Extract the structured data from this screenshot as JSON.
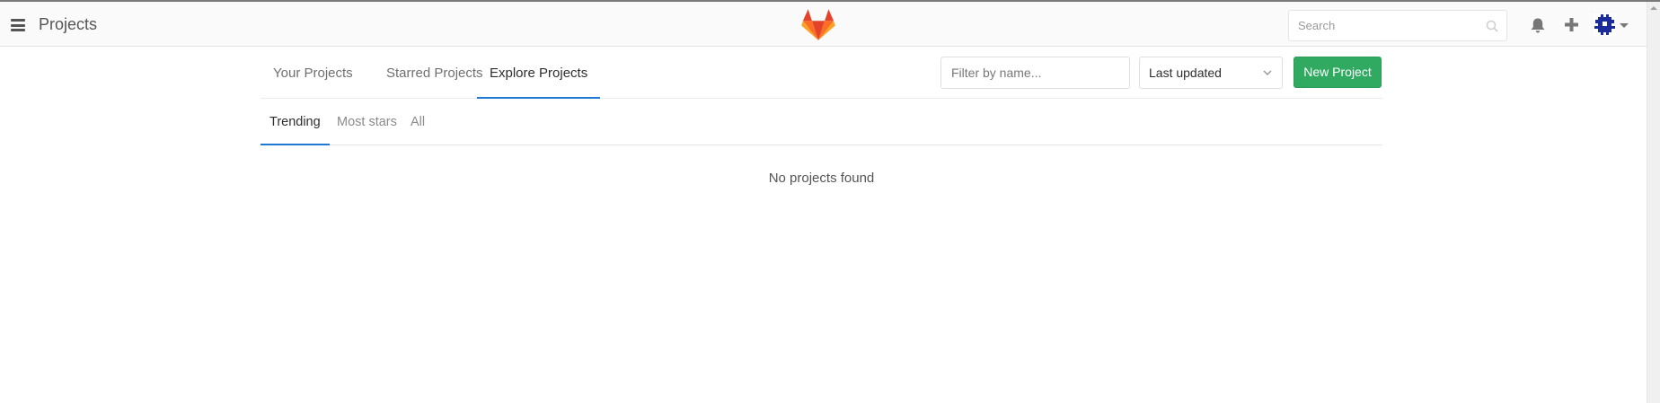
{
  "header": {
    "title": "Projects",
    "menu_icon": "hamburger-menu-icon",
    "logo": "gitlab-tanuki-logo",
    "search": {
      "placeholder": "Search",
      "value": ""
    },
    "icons": [
      "bell-icon",
      "plus-icon",
      "avatar",
      "caret-down-icon"
    ]
  },
  "tabs": [
    {
      "label": "Your Projects",
      "active": false
    },
    {
      "label": "Starred Projects",
      "active": false
    },
    {
      "label": "Explore Projects",
      "active": true
    }
  ],
  "filter": {
    "placeholder": "Filter by name...",
    "value": ""
  },
  "sort": {
    "selected": "Last updated"
  },
  "new_project": {
    "label": "New Project"
  },
  "subtabs": [
    {
      "label": "Trending",
      "active": true
    },
    {
      "label": "Most stars",
      "active": false
    },
    {
      "label": "All",
      "active": false
    }
  ],
  "empty_message": "No projects found",
  "colors": {
    "accent_blue": "#1f78d1",
    "button_green": "#2faa60",
    "avatar_blue": "#1a2c9c"
  }
}
